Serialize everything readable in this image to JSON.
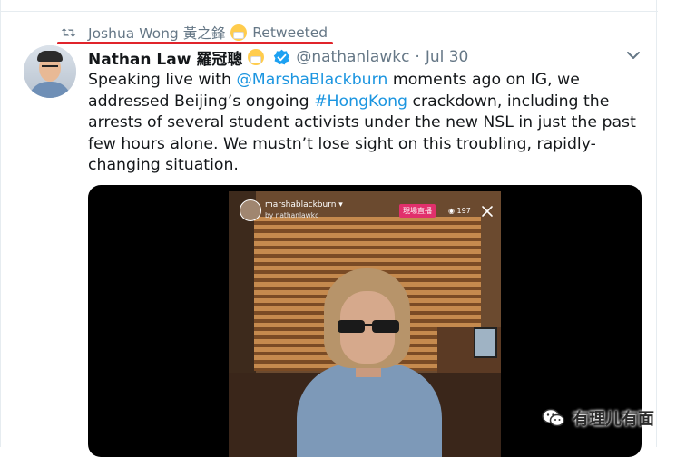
{
  "retweet": {
    "retweeter_name": "Joshua Wong 黃之鋒",
    "suffix": "Retweeted",
    "icon": "retweet-icon",
    "highlight_color": "#e0242b"
  },
  "tweet": {
    "author_name": "Nathan Law 羅冠聰",
    "handle": "@nathanlawkc",
    "separator": "·",
    "date": "Jul 30",
    "verified_icon": "verified-badge-icon",
    "menu_icon": "chevron-down-icon",
    "text_lines": {
      "l1_pre": "Speaking live with ",
      "l1_mention": "@MarshaBlackburn",
      "l1_post": " moments ago on IG, we",
      "l2_pre": "addressed Beijing’s ongoing ",
      "l2_hashtag": "#HongKong",
      "l2_post": " crackdown, including the",
      "l3": "arrests of several student activists under the new NSL in just the past",
      "l4": "few hours alone. We mustn’t lose sight on this troubling, rapidly-",
      "l5": "changing situation."
    },
    "link_color": "#1b95e0"
  },
  "media": {
    "ig_username": "marshablackburn ▾",
    "ig_sub": "by nathanlawkc",
    "live_badge": "現場直播",
    "viewer_count": "◉ 197",
    "close_icon": "close-icon"
  },
  "watermark": {
    "text": "有理儿有面",
    "icon": "wechat-icon"
  }
}
